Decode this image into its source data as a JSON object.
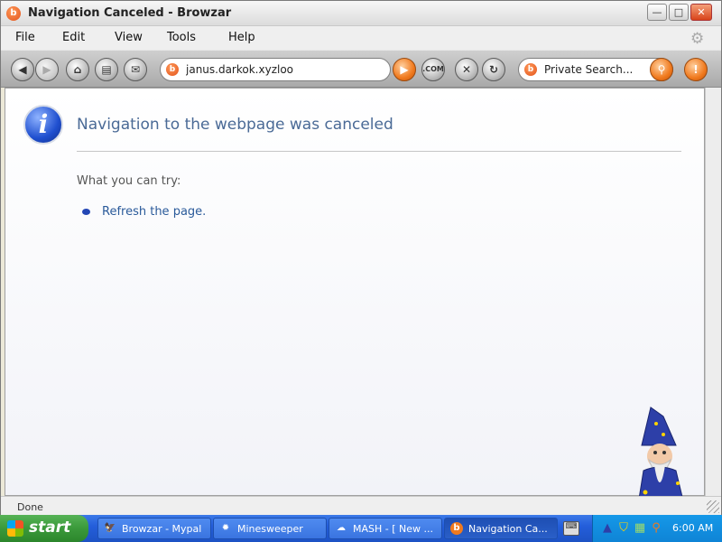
{
  "window": {
    "title": "Navigation Canceled - Browzar",
    "app_icon_glyph": "b",
    "controls": {
      "minimize": "—",
      "maximize": "□",
      "close": "✕"
    }
  },
  "menu": [
    "File",
    "Edit",
    "View",
    "Tools",
    "Help"
  ],
  "toolbar": {
    "back_icon": "◀",
    "forward_icon": "▶",
    "home_icon": "⌂",
    "print_icon": "▤",
    "send_icon": "✉",
    "address": {
      "value": "janus.darkok.xyzloo",
      "favicon_glyph": "b"
    },
    "go_icon": "▶",
    "com_label": ".COM",
    "stop_icon": "✕",
    "refresh_icon": "↻",
    "search": {
      "placeholder": "Private Search...",
      "favicon_glyph": "b",
      "search_icon": "⚲"
    },
    "alert_icon": "!"
  },
  "page": {
    "info_glyph": "i",
    "heading": "Navigation to the webpage was canceled",
    "try_label": "What you can try:",
    "refresh_link": "Refresh the page."
  },
  "status": {
    "text": "Done"
  },
  "taskbar": {
    "start_label": "start",
    "tasks": [
      {
        "label": "Browzar - Mypal",
        "icon": "🦅",
        "active": false
      },
      {
        "label": "Minesweeper",
        "icon": "✹",
        "active": false
      },
      {
        "label": "MASH - [ New ...",
        "icon": "☁",
        "active": false
      },
      {
        "label": "Navigation Ca...",
        "icon": "b",
        "active": true
      }
    ],
    "tray_icons": [
      "wizard-tray-icon",
      "shield-icon",
      "network-icon",
      "search-tray-icon"
    ],
    "clock": "6:00 AM"
  },
  "colors": {
    "heading": "#4a6a96",
    "link": "#2a5a9a",
    "accent_orange": "#f07a1e",
    "taskbar_blue": "#245edb",
    "start_green": "#3a993a"
  }
}
